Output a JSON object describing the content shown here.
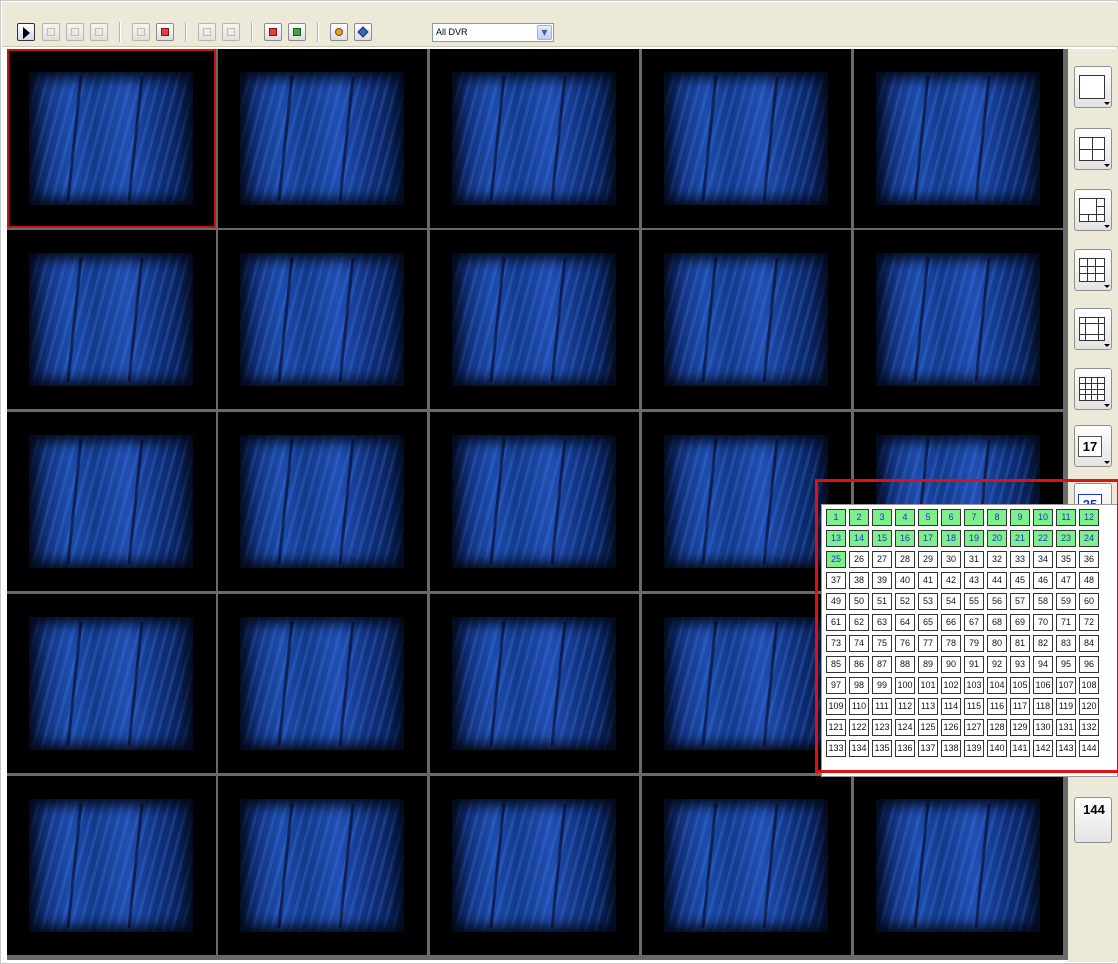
{
  "toolbar": {
    "buttons": [
      {
        "name": "select-pointer-icon",
        "enabled": true
      },
      {
        "name": "zoom-icon",
        "enabled": false
      },
      {
        "name": "layout-icon",
        "enabled": false
      },
      {
        "name": "fullscreen-icon",
        "enabled": false
      },
      {
        "name": "snapshot-icon",
        "enabled": false
      },
      {
        "name": "record-icon",
        "enabled": true
      },
      {
        "name": "play-icon",
        "enabled": false
      },
      {
        "name": "pause-icon",
        "enabled": false
      },
      {
        "name": "sequence-icon",
        "enabled": true
      },
      {
        "name": "export-icon",
        "enabled": true
      },
      {
        "name": "ptz-icon",
        "enabled": true
      },
      {
        "name": "settings-pen-icon",
        "enabled": true
      }
    ],
    "dvr_select": {
      "value": "All DVR"
    }
  },
  "video": {
    "rows": 5,
    "cols": 5,
    "selected_cell": 1
  },
  "layouts": {
    "items": [
      {
        "name": "layout-1-icon",
        "label": ""
      },
      {
        "name": "layout-4-icon",
        "label": ""
      },
      {
        "name": "layout-6-icon",
        "label": ""
      },
      {
        "name": "layout-9-icon",
        "label": ""
      },
      {
        "name": "layout-10-icon",
        "label": ""
      },
      {
        "name": "layout-16-icon",
        "label": ""
      },
      {
        "name": "layout-17",
        "label": "17"
      },
      {
        "name": "layout-25",
        "label": "25"
      },
      {
        "name": "layout-144",
        "label": "144"
      }
    ]
  },
  "channel_popup": {
    "highlighted": 25,
    "channels": [
      "1",
      "2",
      "3",
      "4",
      "5",
      "6",
      "7",
      "8",
      "9",
      "10",
      "11",
      "12",
      "13",
      "14",
      "15",
      "16",
      "17",
      "18",
      "19",
      "20",
      "21",
      "22",
      "23",
      "24",
      "25",
      "26",
      "27",
      "28",
      "29",
      "30",
      "31",
      "32",
      "33",
      "34",
      "35",
      "36",
      "37",
      "38",
      "39",
      "40",
      "41",
      "42",
      "43",
      "44",
      "45",
      "46",
      "47",
      "48",
      "49",
      "50",
      "51",
      "52",
      "53",
      "54",
      "55",
      "56",
      "57",
      "58",
      "59",
      "60",
      "61",
      "62",
      "63",
      "64",
      "65",
      "66",
      "67",
      "68",
      "69",
      "70",
      "71",
      "72",
      "73",
      "74",
      "75",
      "76",
      "77",
      "78",
      "79",
      "80",
      "81",
      "82",
      "83",
      "84",
      "85",
      "86",
      "87",
      "88",
      "89",
      "90",
      "91",
      "92",
      "93",
      "94",
      "95",
      "96",
      "97",
      "98",
      "99",
      "100",
      "101",
      "102",
      "103",
      "104",
      "105",
      "106",
      "107",
      "108",
      "109",
      "110",
      "111",
      "112",
      "113",
      "114",
      "115",
      "116",
      "117",
      "118",
      "119",
      "120",
      "121",
      "122",
      "123",
      "124",
      "125",
      "126",
      "127",
      "128",
      "129",
      "130",
      "131",
      "132",
      "133",
      "134",
      "135",
      "136",
      "137",
      "138",
      "139",
      "140",
      "141",
      "142",
      "143",
      "144"
    ]
  },
  "colors": {
    "selection": "#cc1111",
    "callout": "#e01010",
    "active_channel": "#7df08b",
    "panel_bg": "#ece9d8"
  }
}
